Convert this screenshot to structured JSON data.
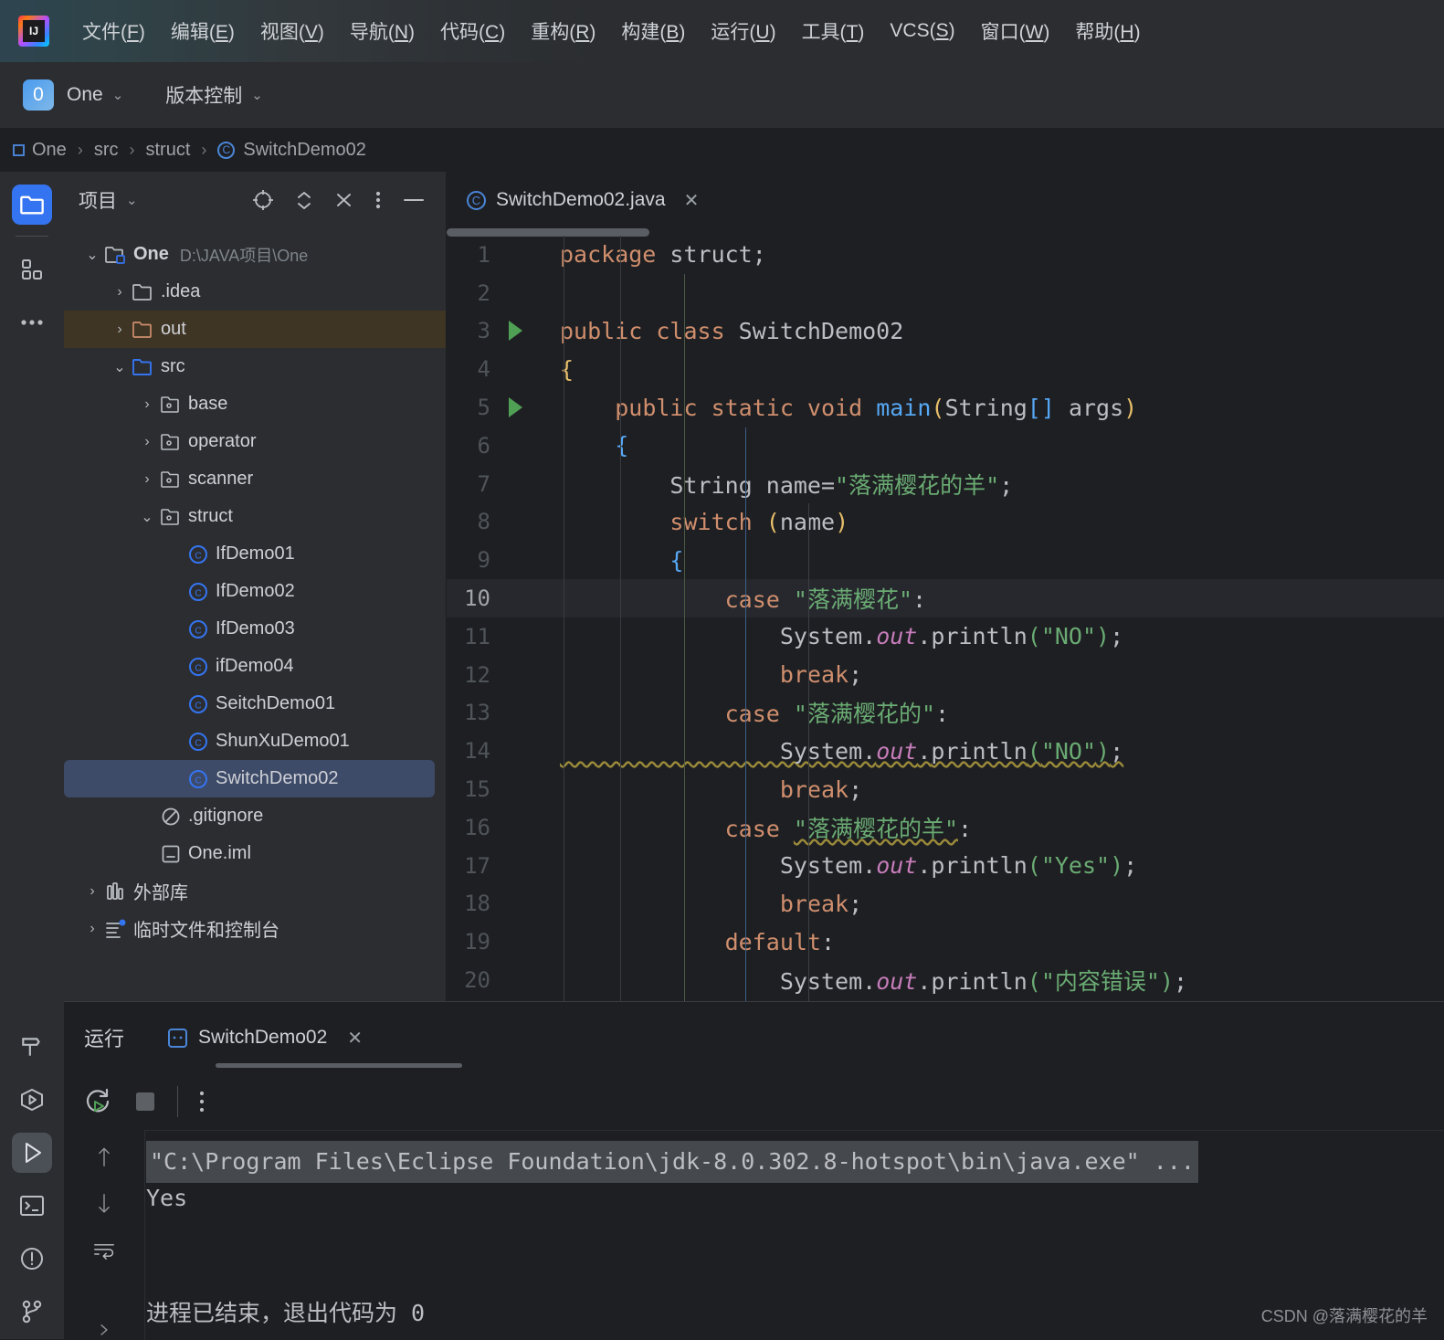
{
  "app": {
    "logo_text": "IJ",
    "menus": [
      {
        "label": "文件(F)",
        "key": "F"
      },
      {
        "label": "编辑(E)",
        "key": "E"
      },
      {
        "label": "视图(V)",
        "key": "V"
      },
      {
        "label": "导航(N)",
        "key": "N"
      },
      {
        "label": "代码(C)",
        "key": "C"
      },
      {
        "label": "重构(R)",
        "key": "R"
      },
      {
        "label": "构建(B)",
        "key": "B"
      },
      {
        "label": "运行(U)",
        "key": "U"
      },
      {
        "label": "工具(T)",
        "key": "T"
      },
      {
        "label": "VCS(S)",
        "key": "S"
      },
      {
        "label": "窗口(W)",
        "key": "W"
      },
      {
        "label": "帮助(H)",
        "key": "H"
      }
    ]
  },
  "toolbar": {
    "project_badge": "0",
    "project_name": "One",
    "vcs_label": "版本控制"
  },
  "breadcrumb": {
    "items": [
      "One",
      "src",
      "struct",
      "SwitchDemo02"
    ],
    "separator": "›"
  },
  "project_panel": {
    "title": "项目",
    "tree": [
      {
        "depth": 0,
        "twisty": "down",
        "icon": "module-folder",
        "label": "One",
        "path": "D:\\JAVA项目\\One",
        "bold": true,
        "state": "normal"
      },
      {
        "depth": 1,
        "twisty": "right",
        "icon": "folder-gray",
        "label": ".idea",
        "state": "normal"
      },
      {
        "depth": 1,
        "twisty": "right",
        "icon": "folder-orange",
        "label": "out",
        "state": "highlight"
      },
      {
        "depth": 1,
        "twisty": "down",
        "icon": "folder-blue",
        "label": "src",
        "state": "normal"
      },
      {
        "depth": 2,
        "twisty": "right",
        "icon": "package",
        "label": "base",
        "state": "normal"
      },
      {
        "depth": 2,
        "twisty": "right",
        "icon": "package",
        "label": "operator",
        "state": "normal"
      },
      {
        "depth": 2,
        "twisty": "right",
        "icon": "package",
        "label": "scanner",
        "state": "normal"
      },
      {
        "depth": 2,
        "twisty": "down",
        "icon": "package",
        "label": "struct",
        "state": "normal"
      },
      {
        "depth": 3,
        "twisty": "none",
        "icon": "class",
        "label": "IfDemo01",
        "state": "normal"
      },
      {
        "depth": 3,
        "twisty": "none",
        "icon": "class",
        "label": "IfDemo02",
        "state": "normal"
      },
      {
        "depth": 3,
        "twisty": "none",
        "icon": "class",
        "label": "IfDemo03",
        "state": "normal"
      },
      {
        "depth": 3,
        "twisty": "none",
        "icon": "class",
        "label": "ifDemo04",
        "state": "normal"
      },
      {
        "depth": 3,
        "twisty": "none",
        "icon": "class",
        "label": "SeitchDemo01",
        "state": "normal"
      },
      {
        "depth": 3,
        "twisty": "none",
        "icon": "class",
        "label": "ShunXuDemo01",
        "state": "normal"
      },
      {
        "depth": 3,
        "twisty": "none",
        "icon": "class",
        "label": "SwitchDemo02",
        "state": "selected"
      },
      {
        "depth": 2,
        "twisty": "none",
        "icon": "gitignore",
        "label": ".gitignore",
        "state": "normal"
      },
      {
        "depth": 2,
        "twisty": "none",
        "icon": "iml",
        "label": "One.iml",
        "state": "normal"
      },
      {
        "depth": 0,
        "twisty": "right",
        "icon": "library",
        "label": "外部库",
        "state": "normal"
      },
      {
        "depth": 0,
        "twisty": "right",
        "icon": "scratches",
        "label": "临时文件和控制台",
        "state": "normal"
      }
    ]
  },
  "editor": {
    "tab_title": "SwitchDemo02.java",
    "close_glyph": "✕",
    "current_line": 10,
    "lines": [
      {
        "n": 1,
        "run": false,
        "tokens": [
          {
            "t": "package ",
            "c": "kw"
          },
          {
            "t": "struct",
            "c": "id"
          },
          {
            "t": ";",
            "c": "id"
          }
        ]
      },
      {
        "n": 2,
        "run": false,
        "tokens": []
      },
      {
        "n": 3,
        "run": true,
        "tokens": [
          {
            "t": "public class ",
            "c": "kw"
          },
          {
            "t": "SwitchDemo02",
            "c": "id"
          }
        ]
      },
      {
        "n": 4,
        "run": false,
        "tokens": [
          {
            "t": "{",
            "c": "br1"
          }
        ]
      },
      {
        "n": 5,
        "run": true,
        "tokens": [
          {
            "t": "    ",
            "c": "id"
          },
          {
            "t": "public static void ",
            "c": "kw"
          },
          {
            "t": "main",
            "c": "fn"
          },
          {
            "t": "(",
            "c": "br1"
          },
          {
            "t": "String",
            "c": "id"
          },
          {
            "t": "[]",
            "c": "br2"
          },
          {
            "t": " args",
            "c": "id"
          },
          {
            "t": ")",
            "c": "br1"
          }
        ]
      },
      {
        "n": 6,
        "run": false,
        "tokens": [
          {
            "t": "    ",
            "c": "id"
          },
          {
            "t": "{",
            "c": "br2"
          }
        ]
      },
      {
        "n": 7,
        "run": false,
        "tokens": [
          {
            "t": "        String name=",
            "c": "id"
          },
          {
            "t": "\"落满樱花的羊\"",
            "c": "str"
          },
          {
            "t": ";",
            "c": "id"
          }
        ]
      },
      {
        "n": 8,
        "run": false,
        "tokens": [
          {
            "t": "        ",
            "c": "id"
          },
          {
            "t": "switch ",
            "c": "kw"
          },
          {
            "t": "(",
            "c": "br1"
          },
          {
            "t": "name",
            "c": "id"
          },
          {
            "t": ")",
            "c": "br1"
          }
        ]
      },
      {
        "n": 9,
        "run": false,
        "tokens": [
          {
            "t": "        ",
            "c": "id"
          },
          {
            "t": "{",
            "c": "br2"
          }
        ]
      },
      {
        "n": 10,
        "run": false,
        "tokens": [
          {
            "t": "            ",
            "c": "id"
          },
          {
            "t": "case ",
            "c": "kw"
          },
          {
            "t": "\"落满樱花\"",
            "c": "str"
          },
          {
            "t": ":",
            "c": "id"
          }
        ]
      },
      {
        "n": 11,
        "run": false,
        "tokens": [
          {
            "t": "                System.",
            "c": "id"
          },
          {
            "t": "out",
            "c": "st"
          },
          {
            "t": ".",
            "c": "id"
          },
          {
            "t": "println",
            "c": "id"
          },
          {
            "t": "(",
            "c": "br3"
          },
          {
            "t": "\"NO\"",
            "c": "str"
          },
          {
            "t": ")",
            "c": "br3"
          },
          {
            "t": ";",
            "c": "id"
          }
        ]
      },
      {
        "n": 12,
        "run": false,
        "tokens": [
          {
            "t": "                ",
            "c": "id"
          },
          {
            "t": "break",
            "c": "kw"
          },
          {
            "t": ";",
            "c": "id"
          }
        ]
      },
      {
        "n": 13,
        "run": false,
        "tokens": [
          {
            "t": "            ",
            "c": "id"
          },
          {
            "t": "case ",
            "c": "kw"
          },
          {
            "t": "\"落满樱花的\"",
            "c": "str"
          },
          {
            "t": ":",
            "c": "id"
          }
        ]
      },
      {
        "n": 14,
        "run": false,
        "warn": true,
        "tokens": [
          {
            "t": "                System.",
            "c": "id"
          },
          {
            "t": "out",
            "c": "st"
          },
          {
            "t": ".",
            "c": "id"
          },
          {
            "t": "println",
            "c": "id"
          },
          {
            "t": "(",
            "c": "br3"
          },
          {
            "t": "\"NO\"",
            "c": "str"
          },
          {
            "t": ")",
            "c": "br3"
          },
          {
            "t": ";",
            "c": "id"
          }
        ]
      },
      {
        "n": 15,
        "run": false,
        "tokens": [
          {
            "t": "                ",
            "c": "id"
          },
          {
            "t": "break",
            "c": "kw"
          },
          {
            "t": ";",
            "c": "id"
          }
        ]
      },
      {
        "n": 16,
        "run": false,
        "warnstr": true,
        "tokens": [
          {
            "t": "            ",
            "c": "id"
          },
          {
            "t": "case ",
            "c": "kw"
          },
          {
            "t": "\"落满樱花的羊\"",
            "c": "str",
            "w": true
          },
          {
            "t": ":",
            "c": "id"
          }
        ]
      },
      {
        "n": 17,
        "run": false,
        "tokens": [
          {
            "t": "                System.",
            "c": "id"
          },
          {
            "t": "out",
            "c": "st"
          },
          {
            "t": ".",
            "c": "id"
          },
          {
            "t": "println",
            "c": "id"
          },
          {
            "t": "(",
            "c": "br3"
          },
          {
            "t": "\"Yes\"",
            "c": "str"
          },
          {
            "t": ")",
            "c": "br3"
          },
          {
            "t": ";",
            "c": "id"
          }
        ]
      },
      {
        "n": 18,
        "run": false,
        "tokens": [
          {
            "t": "                ",
            "c": "id"
          },
          {
            "t": "break",
            "c": "kw"
          },
          {
            "t": ";",
            "c": "id"
          }
        ]
      },
      {
        "n": 19,
        "run": false,
        "tokens": [
          {
            "t": "            ",
            "c": "id"
          },
          {
            "t": "default",
            "c": "kw"
          },
          {
            "t": ":",
            "c": "id"
          }
        ]
      },
      {
        "n": 20,
        "run": false,
        "tokens": [
          {
            "t": "                System.",
            "c": "id"
          },
          {
            "t": "out",
            "c": "st"
          },
          {
            "t": ".",
            "c": "id"
          },
          {
            "t": "println",
            "c": "id"
          },
          {
            "t": "(",
            "c": "br3"
          },
          {
            "t": "\"内容错误\"",
            "c": "str"
          },
          {
            "t": ")",
            "c": "br3"
          },
          {
            "t": ";",
            "c": "id"
          }
        ]
      }
    ]
  },
  "run_panel": {
    "label": "运行",
    "tab_title": "SwitchDemo02",
    "close_glyph": "✕",
    "console": [
      {
        "text": "\"C:\\Program Files\\Eclipse Foundation\\jdk-8.0.302.8-hotspot\\bin\\java.exe\" ...",
        "style": "cmd"
      },
      {
        "text": "Yes",
        "style": "normal"
      },
      {
        "text": "",
        "style": "normal"
      },
      {
        "text": "",
        "style": "normal"
      },
      {
        "text": "进程已结束，退出代码为 0",
        "style": "normal"
      }
    ]
  },
  "watermark": "CSDN @落满樱花的羊",
  "colors": {
    "accent_blue": "#3574f0",
    "bg_editor": "#1e1f22",
    "bg_panel": "#2b2d30",
    "keyword": "#cf8e6d",
    "string": "#6aab73",
    "method": "#56a8f5",
    "static_field": "#c77dbb",
    "selection": "#3d4a68",
    "highlight_out": "#3e3524"
  }
}
